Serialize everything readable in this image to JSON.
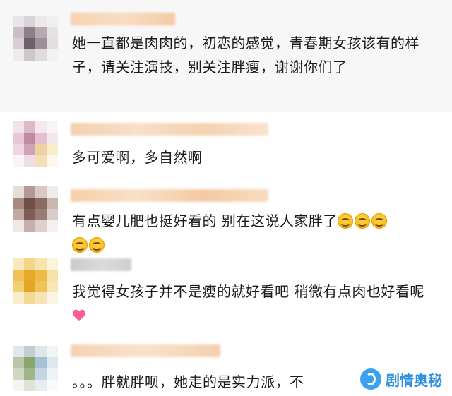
{
  "comments": [
    {
      "text": "她一直都是肉肉的，初恋的感觉，青春期女孩该有的样子，请关注演技，别关注胖瘦，谢谢你们了"
    },
    {
      "text": "多可爱啊，多自然啊"
    },
    {
      "text": "有点婴儿肥也挺好看的 别在这说人家胖了",
      "emoji_count": 5
    },
    {
      "text": "我觉得女孩子并不是瘦的就好看吧 稍微有点肉也好看呢"
    },
    {
      "text": "。。。胖就胖呗，她走的是实力派，不"
    }
  ],
  "watermark": {
    "text": "剧情奥秘",
    "icon": "logo-icon"
  },
  "colors": {
    "name_blur": "#f3c89f",
    "heart": "#ff5f8f",
    "emoji": "#f5b91a",
    "watermark": "#2f8fe0"
  }
}
